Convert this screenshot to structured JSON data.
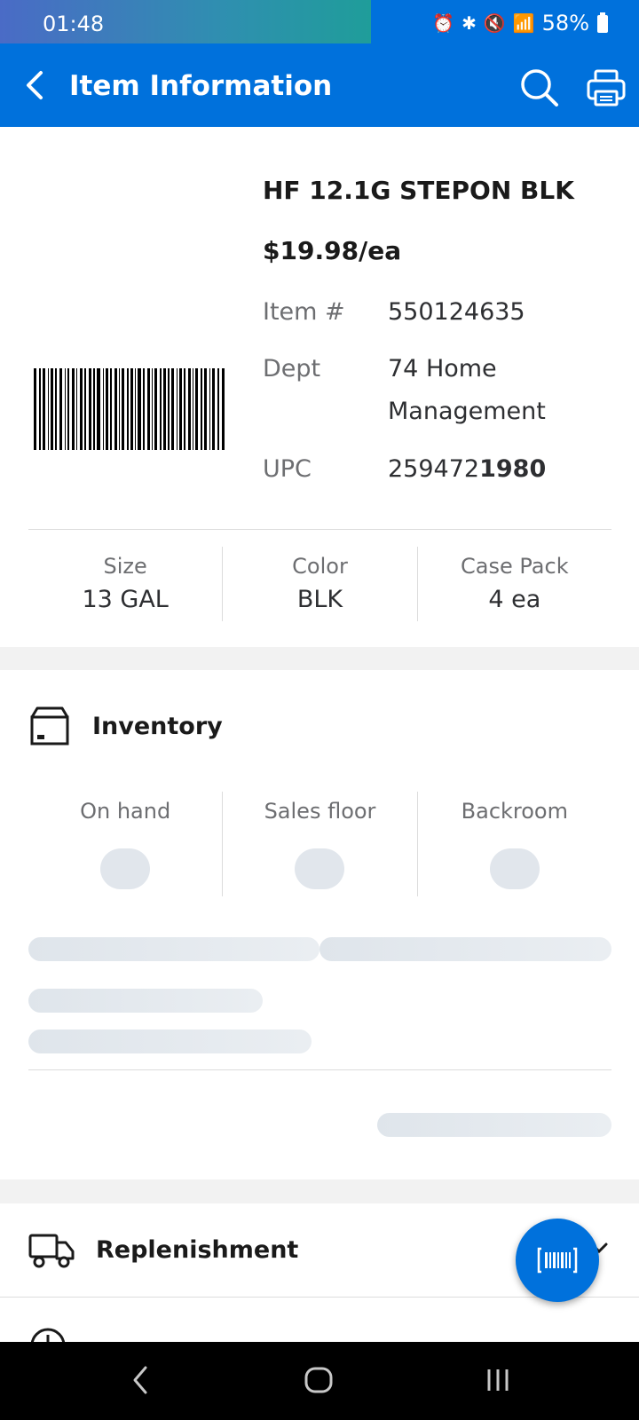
{
  "status_bar": {
    "time": "01:48",
    "battery": "58%"
  },
  "header": {
    "title": "Item Information"
  },
  "product": {
    "name": "HF 12.1G STEPON BLK",
    "price": "$19.98/ea",
    "details": [
      {
        "label": "Item #",
        "value": "550124635"
      },
      {
        "label": "Dept",
        "value_line1": "74 Home",
        "value_line2": "Management"
      },
      {
        "label": "UPC",
        "value_prefix": "259472",
        "value_bold": "1980"
      }
    ],
    "attributes": [
      {
        "label": "Size",
        "value": "13 GAL"
      },
      {
        "label": "Color",
        "value": "BLK"
      },
      {
        "label": "Case Pack",
        "value": "4 ea"
      }
    ]
  },
  "inventory": {
    "title": "Inventory",
    "columns": [
      "On hand",
      "Sales floor",
      "Backroom"
    ]
  },
  "replenishment": {
    "title": "Replenishment"
  },
  "colors": {
    "primary": "#0071dc",
    "skeleton": "#e1e6ec",
    "section_gap": "#f2f2f2"
  },
  "icons": [
    "back-icon",
    "search-icon",
    "print-icon",
    "box-icon",
    "truck-icon",
    "barcode-scan-icon"
  ]
}
